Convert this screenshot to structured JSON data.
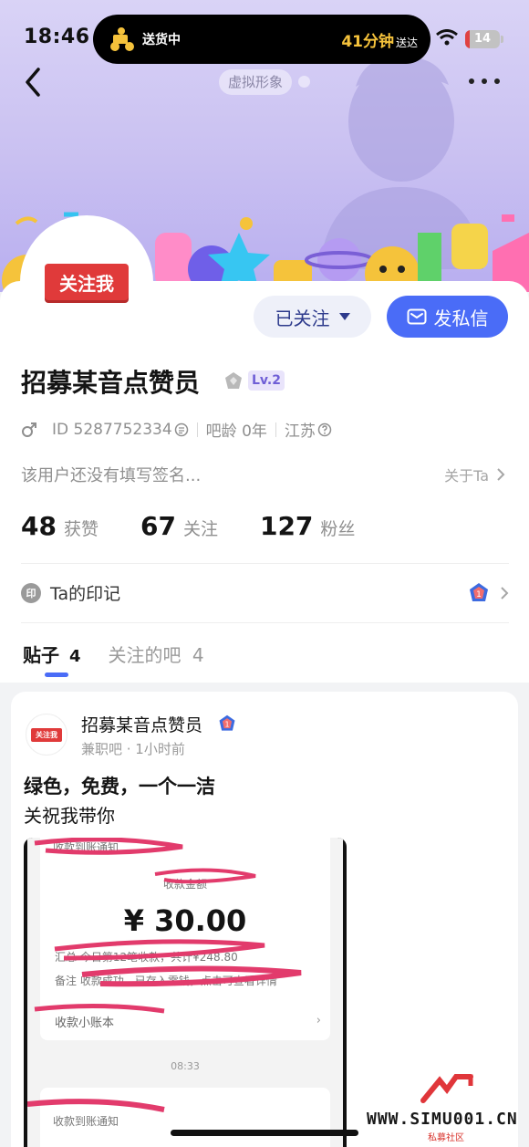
{
  "status_bar": {
    "time": "18:46",
    "battery": "14",
    "battery_level": 0.14
  },
  "live_activity": {
    "left_text": "送货中",
    "eta": "41分钟",
    "arrive": "送达"
  },
  "header": {
    "avatar_tag": "虚拟形象",
    "back_icon": "chevron-left-icon",
    "more_icon": "ellipsis-icon"
  },
  "profile": {
    "avatar_badge": "关注我",
    "name": "招募某音点赞员",
    "level": "Lv.2",
    "gender_icon": "male-icon",
    "id_label": "ID 5287752334",
    "bar_age": "吧龄 0年",
    "location": "江苏",
    "signature": "该用户还没有填写签名...",
    "about": "关于Ta"
  },
  "actions": {
    "followed_label": "已关注",
    "message_label": "发私信"
  },
  "stats": [
    {
      "num": "48",
      "label": "获赞"
    },
    {
      "num": "67",
      "label": "关注"
    },
    {
      "num": "127",
      "label": "粉丝"
    }
  ],
  "marks": {
    "icon": "印",
    "label": "Ta的印记"
  },
  "tabs": [
    {
      "label": "贴子",
      "count": "4"
    },
    {
      "label": "关注的吧",
      "count": "4"
    }
  ],
  "post": {
    "avatar_badge": "关注我",
    "author": "招募某音点赞员",
    "sub": "兼职吧 · 1小时前",
    "title": "绿色，免费，一个一洁",
    "body": "关祝我带你",
    "screenshot": {
      "top_text": "收款到账通知",
      "sub_title": "收款金额",
      "amount": "¥ 30.00",
      "line1": "汇总 今日第12笔收款，共计¥248.80",
      "line2": "备注 收款成功，已存入零钱，点击可查看详情",
      "notice": "收款小账本",
      "time": "08:33",
      "bottom_text": "收款到账通知"
    }
  },
  "watermark": {
    "text": "WWW.SIMU001.CN",
    "sub": "私募社区"
  },
  "colors": {
    "accent": "#4a6cf7",
    "badge_red": "#e03a3a",
    "banner": "#c9c0f1"
  }
}
